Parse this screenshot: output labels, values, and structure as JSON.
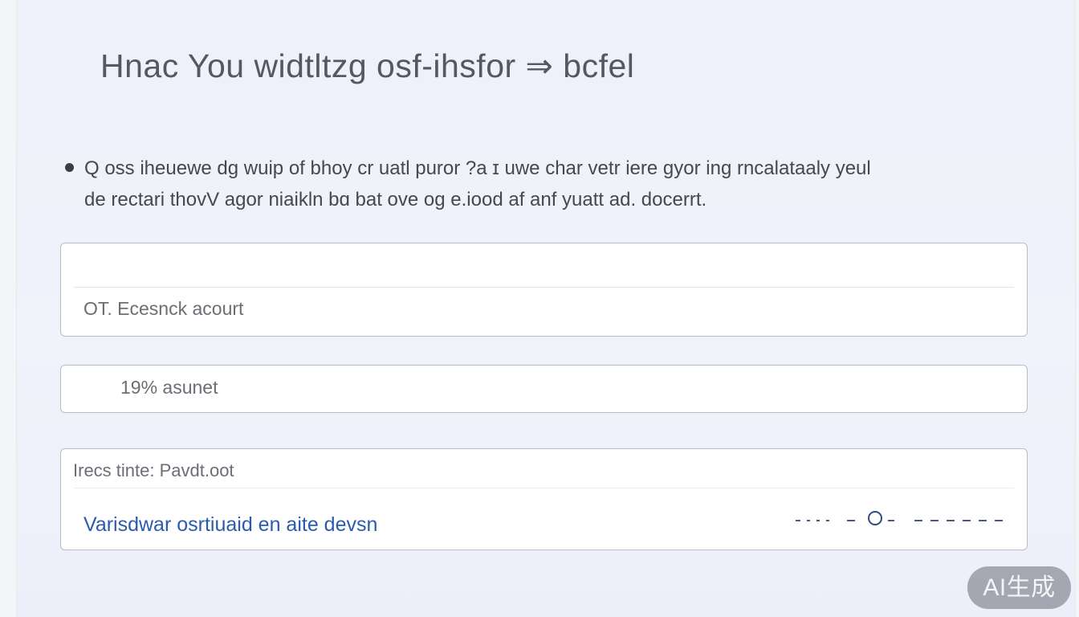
{
  "page": {
    "title": "Hnac You widtltzg osf-ihsfor ⇒ bcfel",
    "paragraph": {
      "line1": "Q oss iheuewe dg wuip of bhoy cr uatl puror ?a ɪ uwe char vetr iere gyor ing rncalataaly yeul",
      "line2": "de rectari thovV agor niaikln bɑ bat ove og e.iood af anf yuatt ad. docerrt."
    }
  },
  "form": {
    "field1_text": "OT. Ecesnck acourt",
    "field2_text": "19% asunet",
    "section_header": "Irecs tinte: Pavdt.oot",
    "link_text": "Varisdwar osrtiuaid en aite devsn"
  },
  "slider": {
    "value_fraction": 0.38
  },
  "watermark": {
    "text": "AI生成"
  },
  "colors": {
    "accent": "#2a5bb0",
    "text": "#46484d",
    "border": "#b7bccb"
  }
}
